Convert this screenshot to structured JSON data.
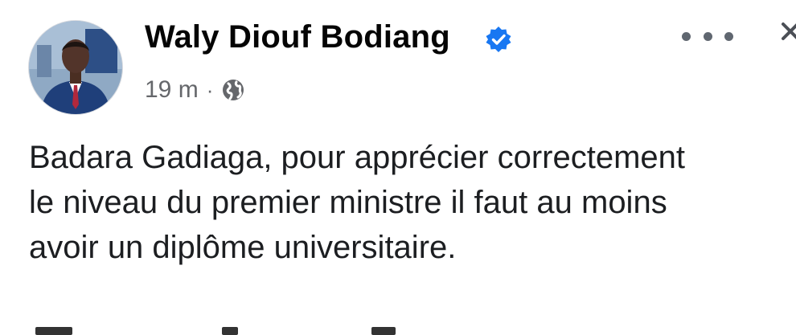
{
  "post": {
    "author": {
      "name": "Waly Diouf Bodiang",
      "verified": true,
      "avatar_icon": "profile-photo"
    },
    "meta": {
      "time": "19 m",
      "separator": "·",
      "audience_icon": "globe-icon"
    },
    "text_lines": [
      "Badara Gadiaga, pour apprécier correctement",
      "le niveau du premier ministre il faut au moins",
      "avoir un diplôme universitaire."
    ],
    "actions": {
      "more_icon": "more-options-icon",
      "close_icon": "close-icon"
    }
  },
  "colors": {
    "verified_blue": "#1877f2",
    "meta_gray": "#65676b",
    "text": "#050505"
  }
}
